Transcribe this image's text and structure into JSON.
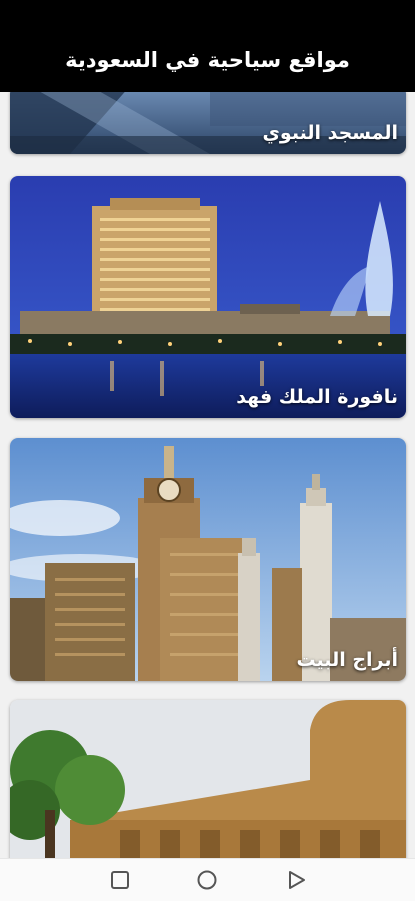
{
  "app": {
    "title": "مواقع سياحية في السعودية"
  },
  "places": [
    {
      "label": "المسجد النبوي"
    },
    {
      "label": "نافورة الملك فهد"
    },
    {
      "label": "أبراج البيت"
    },
    {
      "label": ""
    }
  ],
  "colors": {
    "appbar": "#000000",
    "background": "#f1f1f1",
    "label_text": "#ffffff"
  },
  "nav": {
    "icons": [
      "recent-apps-icon",
      "home-icon",
      "back-icon"
    ]
  }
}
